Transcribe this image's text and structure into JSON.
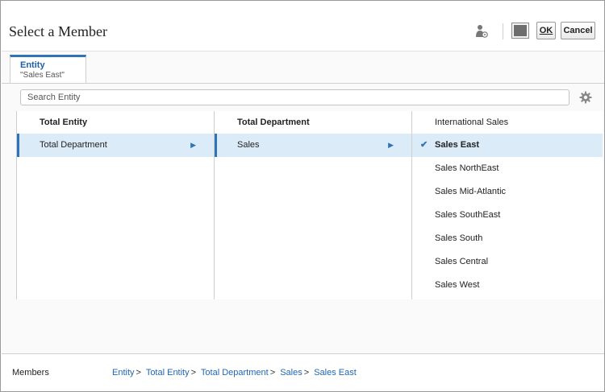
{
  "header": {
    "title": "Select a Member",
    "ok_label": "OK",
    "cancel_label": "Cancel"
  },
  "tab": {
    "label": "Entity",
    "sublabel": "\"Sales East\""
  },
  "search": {
    "placeholder": "Search Entity"
  },
  "columns": [
    {
      "header": "Total Entity",
      "items": [
        {
          "label": "Total Department",
          "selected": true,
          "has_children": true
        }
      ]
    },
    {
      "header": "Total Department",
      "items": [
        {
          "label": "Sales",
          "selected": true,
          "has_children": true
        }
      ]
    },
    {
      "header": "International Sales",
      "items": [
        {
          "label": "Sales East",
          "selected": true,
          "checked": true
        },
        {
          "label": "Sales NorthEast"
        },
        {
          "label": "Sales Mid-Atlantic"
        },
        {
          "label": "Sales SouthEast"
        },
        {
          "label": "Sales South"
        },
        {
          "label": "Sales Central"
        },
        {
          "label": "Sales West"
        }
      ]
    }
  ],
  "footer": {
    "label": "Members",
    "breadcrumb": [
      "Entity",
      "Total Entity",
      "Total Department",
      "Sales",
      "Sales East"
    ],
    "separator": ">"
  },
  "colors": {
    "accent": "#2f73b8",
    "link": "#1f66b3",
    "selected_row": "#dcebf8"
  },
  "icons": {
    "user": "user-settings-icon",
    "panel": "panel-toggle-icon",
    "gear": "gear-icon",
    "arrow": "triangle-right-icon",
    "check": "checkmark-icon"
  }
}
